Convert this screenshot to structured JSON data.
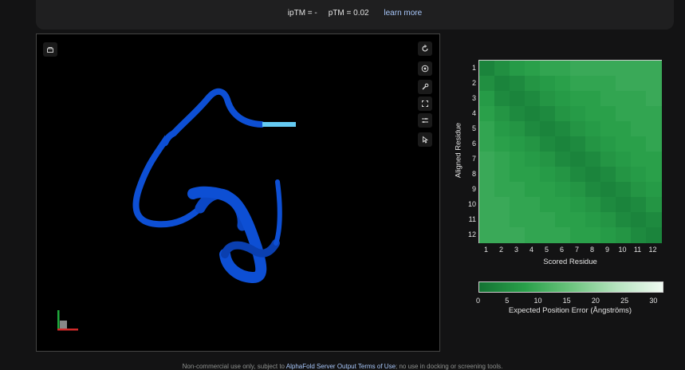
{
  "metrics": {
    "iptm_label": "ipTM = -",
    "ptm_label": "pTM = 0.02",
    "learn_more": "learn more"
  },
  "viewer": {
    "toolbar_icons": [
      "reset-icon",
      "spin-icon",
      "wrench-icon",
      "fullscreen-icon",
      "settings-sliders-icon",
      "pointer-icon"
    ],
    "top_left_icon": "download-icon",
    "colors": {
      "background": "#000000",
      "ribbon_dark": "#0b4fd1",
      "ribbon_light": "#65cbf3"
    }
  },
  "pae_plot": {
    "y_axis_title": "Aligned Residue",
    "x_axis_title": "Scored Residue",
    "residues": [
      "1",
      "2",
      "3",
      "4",
      "5",
      "6",
      "7",
      "8",
      "9",
      "10",
      "11",
      "12"
    ],
    "colorbar_title": "Expected Position Error (Ångströms)",
    "colorbar_ticks": [
      "0",
      "5",
      "10",
      "15",
      "20",
      "25",
      "30"
    ],
    "colorbar_range": [
      0,
      31.75
    ]
  },
  "chart_data": {
    "type": "heatmap",
    "x_categories": [
      "1",
      "2",
      "3",
      "4",
      "5",
      "6",
      "7",
      "8",
      "9",
      "10",
      "11",
      "12"
    ],
    "y_categories": [
      "1",
      "2",
      "3",
      "4",
      "5",
      "6",
      "7",
      "8",
      "9",
      "10",
      "11",
      "12"
    ],
    "xlabel": "Scored Residue",
    "ylabel": "Aligned Residue",
    "colorbar_label": "Expected Position Error (Ångströms)",
    "zlim": [
      0,
      31.75
    ],
    "values": [
      [
        3,
        5,
        7,
        8,
        9,
        9,
        10,
        10,
        10,
        10,
        10,
        10
      ],
      [
        5,
        3,
        4,
        6,
        7,
        8,
        9,
        9,
        9,
        10,
        10,
        10
      ],
      [
        7,
        4,
        3,
        4,
        6,
        7,
        8,
        8,
        9,
        9,
        9,
        10
      ],
      [
        8,
        6,
        4,
        3,
        4,
        6,
        7,
        8,
        8,
        9,
        9,
        9
      ],
      [
        9,
        7,
        6,
        4,
        3,
        4,
        6,
        7,
        8,
        8,
        9,
        9
      ],
      [
        9,
        8,
        7,
        6,
        4,
        3,
        4,
        6,
        7,
        8,
        8,
        9
      ],
      [
        10,
        9,
        8,
        7,
        6,
        4,
        3,
        4,
        6,
        7,
        8,
        8
      ],
      [
        10,
        9,
        8,
        8,
        7,
        6,
        4,
        3,
        4,
        6,
        7,
        8
      ],
      [
        10,
        9,
        9,
        8,
        8,
        7,
        6,
        4,
        3,
        4,
        6,
        7
      ],
      [
        10,
        10,
        9,
        9,
        8,
        8,
        7,
        6,
        4,
        3,
        4,
        6
      ],
      [
        10,
        10,
        9,
        9,
        9,
        8,
        8,
        7,
        6,
        4,
        3,
        4
      ],
      [
        10,
        10,
        10,
        9,
        9,
        9,
        8,
        8,
        7,
        6,
        4,
        3
      ]
    ]
  },
  "footer": {
    "prefix": "Non-commercial use only, subject to ",
    "link": "AlphaFold Server Output Terms of Use",
    "suffix": "; no use in docking or screening tools."
  }
}
